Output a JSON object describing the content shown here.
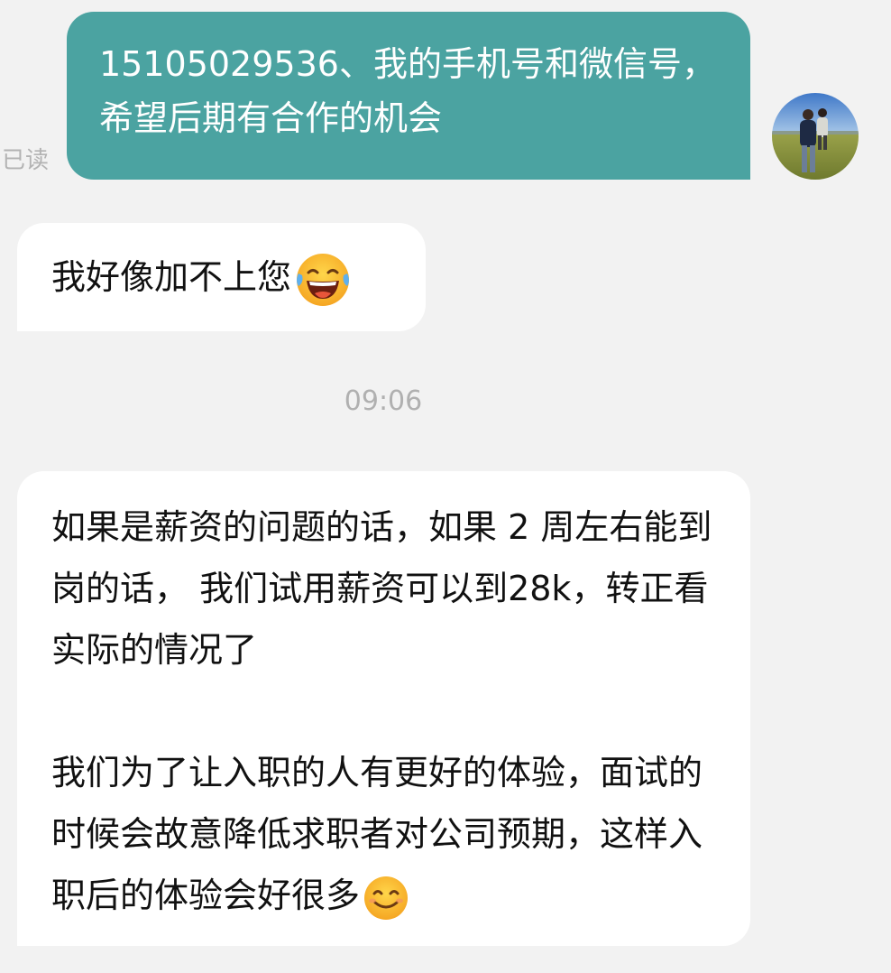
{
  "messages": {
    "outgoing_1": {
      "text": "15105029536、我的手机号和微信号，希望后期有合作的机会",
      "status": "已读"
    },
    "incoming_1": {
      "text": "我好像加不上您",
      "emoji": "tears-of-joy-emoji"
    },
    "timestamp": "09:06",
    "incoming_2": {
      "paragraph_1": "如果是薪资的问题的话，如果 2 周左右能到岗的话， 我们试用薪资可以到28k，转正看实际的情况了",
      "paragraph_2": "我们为了让入职的人有更好的体验，面试的时候会故意降低求职者对公司预期，这样入职后的体验会好很多",
      "emoji": "smiling-face-emoji"
    }
  },
  "colors": {
    "background": "#f2f2f2",
    "outgoing_bubble": "#4ba3a1",
    "incoming_bubble": "#ffffff",
    "muted_text": "#b0b0b0"
  },
  "icons": {
    "avatar": "user-avatar-photo"
  }
}
